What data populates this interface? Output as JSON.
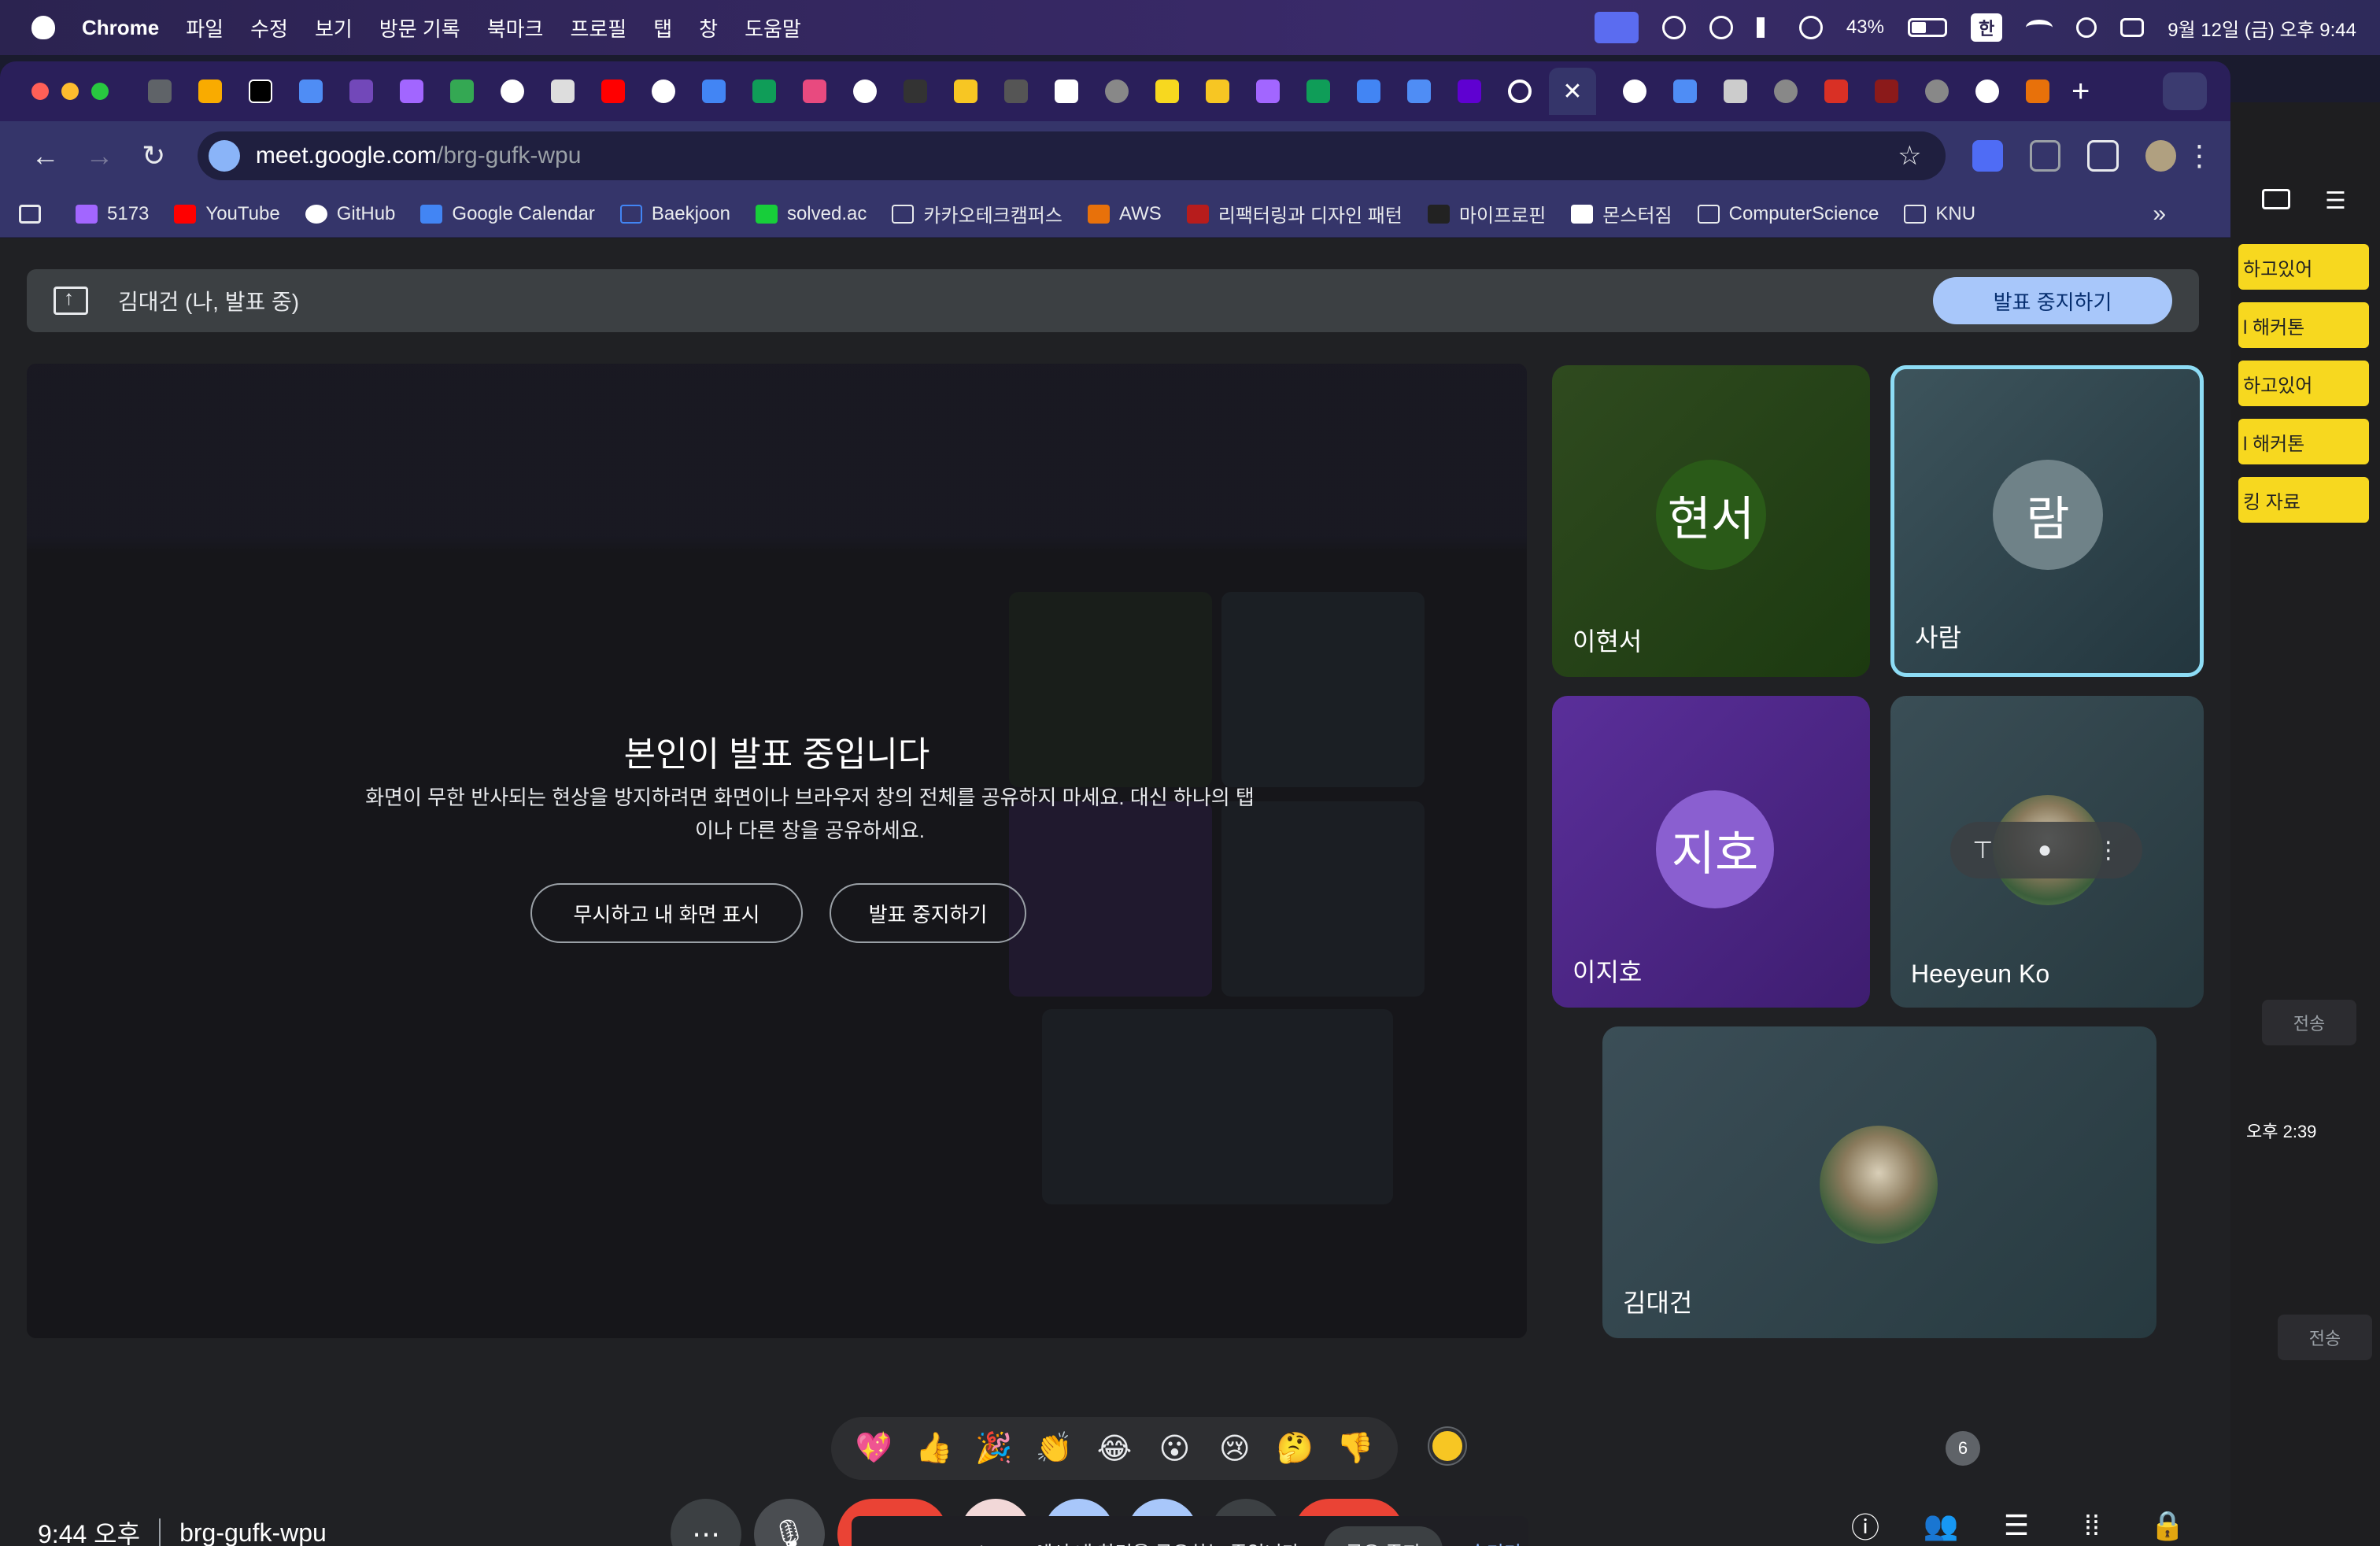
{
  "menubar": {
    "app_name": "Chrome",
    "menus": [
      "파일",
      "수정",
      "보기",
      "방문 기록",
      "북마크",
      "프로필",
      "탭",
      "창",
      "도움말"
    ],
    "battery": "43%",
    "input_mode": "한",
    "datetime": "9월 12일 (금) 오후 9:44"
  },
  "browser": {
    "url_host": "meet.google.com",
    "url_path": "/brg-gufk-wpu",
    "active_tab_close": "✕",
    "bookmarks": [
      "5173",
      "YouTube",
      "GitHub",
      "Google Calendar",
      "Baekjoon",
      "solved.ac",
      "카카오테크캠퍼스",
      "AWS",
      "리팩터링과 디자인 패턴",
      "마이프로핀",
      "몬스터짐",
      "ComputerScience",
      "KNU"
    ],
    "bookmarks_more": "»"
  },
  "meet": {
    "presenting_label": "김대건 (나, 발표 중)",
    "stop_presenting": "발표 중지하기",
    "overlay": {
      "title": "본인이 발표 중입니다",
      "description": "화면이 무한 반사되는 현상을 방지하려면 화면이나 브라우저 창의 전체를 공유하지 마세요. 대신 하나의 탭이나 다른 창을 공유하세요.",
      "ignore_button": "무시하고 내 화면 표시",
      "stop_button": "발표 중지하기"
    },
    "participants": [
      {
        "name": "이현서",
        "initials": "현서",
        "color": "#2f5a1f"
      },
      {
        "name": "사람",
        "initials": "람",
        "color": "#4e6168"
      },
      {
        "name": "이지호",
        "initials": "지호",
        "color": "#6a3fb0"
      },
      {
        "name": "Heeyeun Ko",
        "initials": ""
      },
      {
        "name": "김대건",
        "initials": ""
      }
    ],
    "reactions": [
      "💖",
      "👍",
      "🎉",
      "👏",
      "😂",
      "😮",
      "😢",
      "🤔",
      "👎"
    ],
    "time": "9:44 오후",
    "meeting_code": "brg-gufk-wpu",
    "share_banner": {
      "text": "meet.google.com에서 내 화면을 공유하는 중입니다.",
      "stop_share": "공유 중지",
      "hide": "숨기기"
    },
    "people_count": "6"
  },
  "side_window": {
    "notes": [
      "하고있어",
      "l 해커톤",
      "하고있어",
      "l 해커톤",
      "킹 자료"
    ],
    "send": "전송",
    "time": "오후 2:39"
  }
}
